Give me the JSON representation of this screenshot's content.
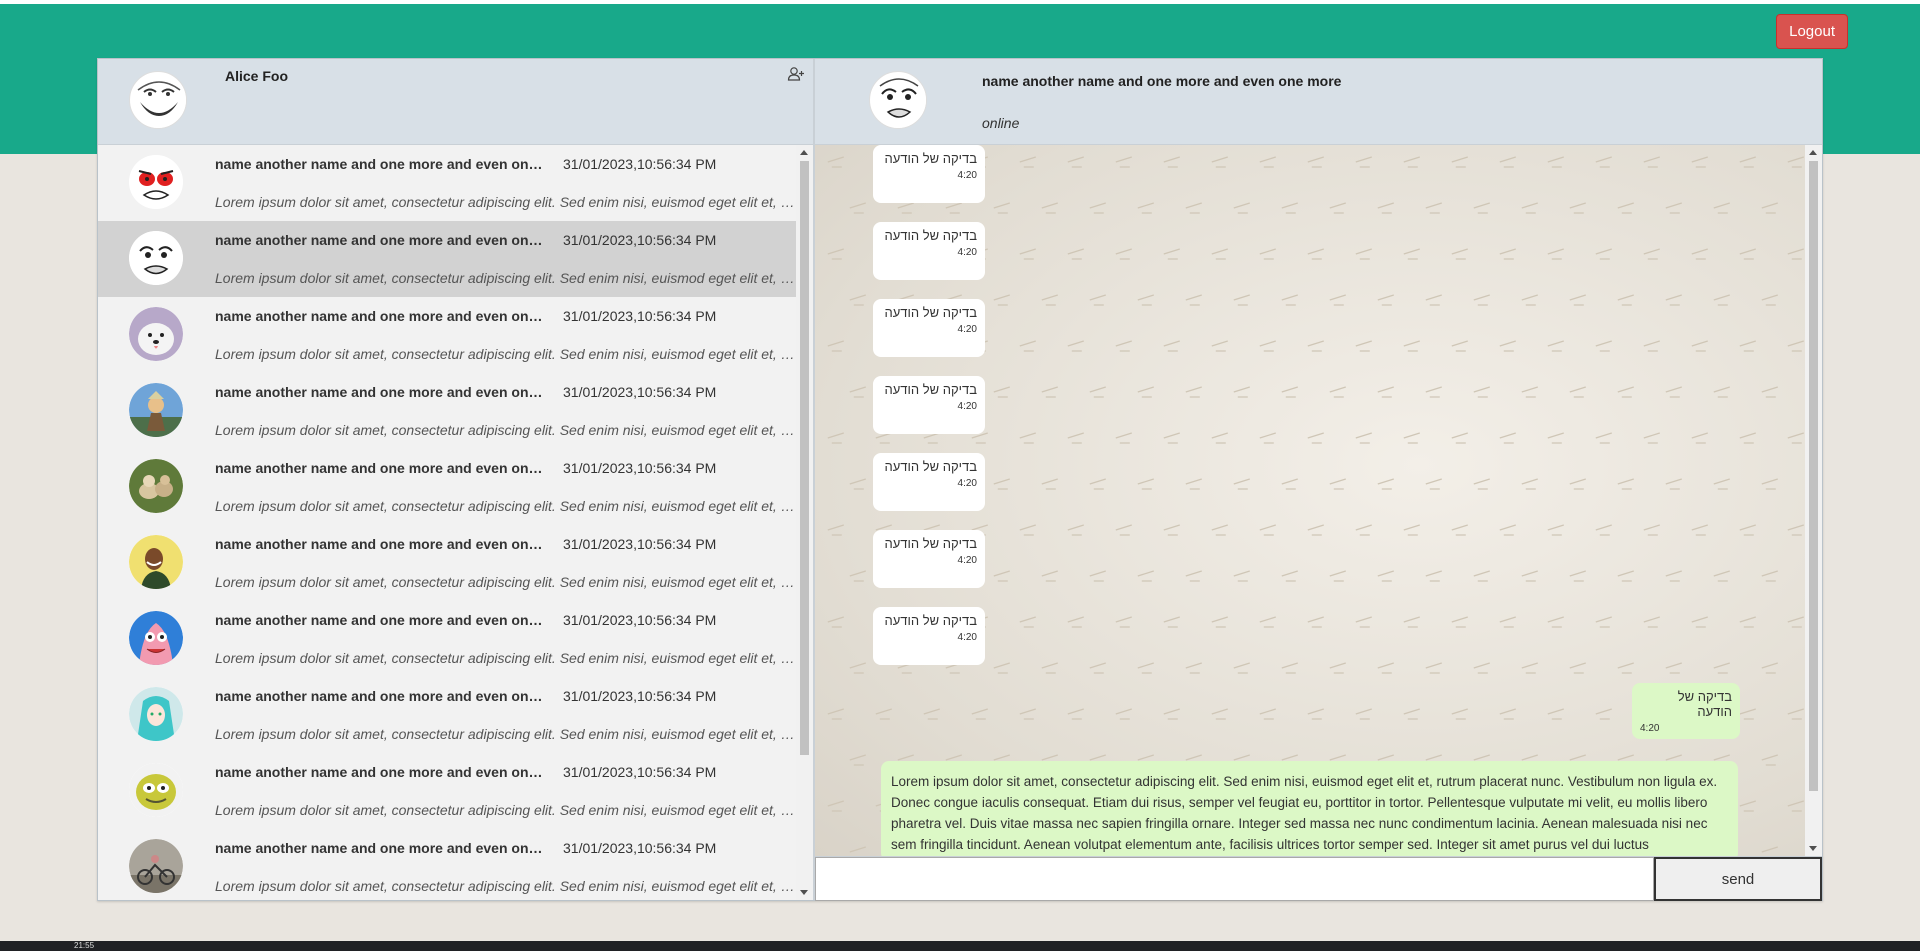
{
  "header": {
    "logout_label": "Logout"
  },
  "me": {
    "name": "Alice Foo"
  },
  "contacts": [
    {
      "name": "name another name and one more and even one more",
      "time": "31/01/2023,10:56:34 PM",
      "last_message": "Lorem ipsum dolor sit amet, consectetur adipiscing elit. Sed enim nisi, euismod eget elit et, rutrum placerat nunc.",
      "avatar": "rage-face"
    },
    {
      "name": "name another name and one more and even one more",
      "time": "31/01/2023,10:56:34 PM",
      "last_message": "Lorem ipsum dolor sit amet, consectetur adipiscing elit. Sed enim nisi, euismod eget elit et, rutrum placerat nunc.",
      "avatar": "meme-face",
      "selected": true
    },
    {
      "name": "name another name and one more and even one more",
      "time": "31/01/2023,10:56:34 PM",
      "last_message": "Lorem ipsum dolor sit amet, consectetur adipiscing elit. Sed enim nisi, euismod eget elit et, rutrum placerat nunc.",
      "avatar": "dog"
    },
    {
      "name": "name another name and one more and even one more",
      "time": "31/01/2023,10:56:34 PM",
      "last_message": "Lorem ipsum dolor sit amet, consectetur adipiscing elit. Sed enim nisi, euismod eget elit et, rutrum placerat nunc.",
      "avatar": "character"
    },
    {
      "name": "name another name and one more and even one more",
      "time": "31/01/2023,10:56:34 PM",
      "last_message": "Lorem ipsum dolor sit amet, consectetur adipiscing elit. Sed enim nisi, euismod eget elit et, rutrum placerat nunc.",
      "avatar": "dogs"
    },
    {
      "name": "name another name and one more and even one more",
      "time": "31/01/2023,10:56:34 PM",
      "last_message": "Lorem ipsum dolor sit amet, consectetur adipiscing elit. Sed enim nisi, euismod eget elit et, rutrum placerat nunc.",
      "avatar": "person"
    },
    {
      "name": "name another name and one more and even one more",
      "time": "31/01/2023,10:56:34 PM",
      "last_message": "Lorem ipsum dolor sit amet, consectetur adipiscing elit. Sed enim nisi, euismod eget elit et, rutrum placerat nunc.",
      "avatar": "patrick"
    },
    {
      "name": "name another name and one more and even one more",
      "time": "31/01/2023,10:56:34 PM",
      "last_message": "Lorem ipsum dolor sit amet, consectetur adipiscing elit. Sed enim nisi, euismod eget elit et, rutrum placerat nunc.",
      "avatar": "anime"
    },
    {
      "name": "name another name and one more and even one more",
      "time": "31/01/2023,10:56:34 PM",
      "last_message": "Lorem ipsum dolor sit amet, consectetur adipiscing elit. Sed enim nisi, euismod eget elit et, rutrum placerat nunc.",
      "avatar": "cartoon"
    },
    {
      "name": "name another name and one more and even one more",
      "time": "31/01/2023,10:56:34 PM",
      "last_message": "Lorem ipsum dolor sit amet, consectetur adipiscing elit. Sed enim nisi, euismod eget elit et, rutrum placerat nunc.",
      "avatar": "cyclist"
    }
  ],
  "chat": {
    "peer_name": "name another name and one more and even one more",
    "peer_status": "online",
    "incoming": [
      {
        "text": "בדיקה של הודעה",
        "time": "4:20"
      },
      {
        "text": "בדיקה של הודעה",
        "time": "4:20"
      },
      {
        "text": "בדיקה של הודעה",
        "time": "4:20"
      },
      {
        "text": "בדיקה של הודעה",
        "time": "4:20"
      },
      {
        "text": "בדיקה של הודעה",
        "time": "4:20"
      },
      {
        "text": "בדיקה של הודעה",
        "time": "4:20"
      },
      {
        "text": "בדיקה של הודעה",
        "time": "4:20"
      }
    ],
    "outgoing": {
      "text": "בדיקה של הודעה",
      "time": "4:20"
    },
    "long_message": "Lorem ipsum dolor sit amet, consectetur adipiscing elit. Sed enim nisi, euismod eget elit et, rutrum placerat nunc. Vestibulum non ligula ex. Donec congue iaculis consequat. Etiam dui risus, semper vel feugiat eu, porttitor in tortor. Pellentesque vulputate mi velit, eu mollis libero pharetra vel. Duis vitae massa nec sapien fringilla ornare. Integer sed massa nec nunc condimentum lacinia. Aenean malesuada nisi nec sem fringilla tincidunt. Aenean volutpat elementum ante, facilisis ultrices tortor semper sed. Integer sit amet purus vel dui luctus"
  },
  "composer": {
    "input_value": "",
    "send_label": "send"
  },
  "taskbar": {
    "clock": "21:55"
  },
  "colors": {
    "header_green": "#18a98a",
    "logout_red": "#d9534f",
    "outgoing_bubble": "#dcf8c6",
    "panel_header": "#d8e0e7"
  }
}
